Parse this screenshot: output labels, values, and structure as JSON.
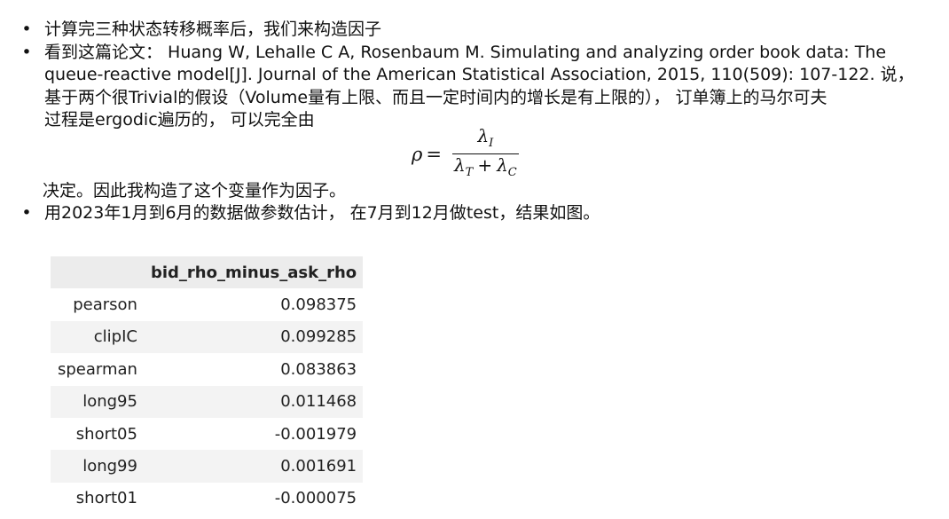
{
  "bullets": {
    "b1": "计算完三种状态转移概率后，我们来构造因子",
    "b2_line1": "看到这篇论文：  Huang W, Lehalle C A, Rosenbaum M. Simulating and analyzing order book data: The",
    "b2_line2": "queue-reactive model[J]. Journal of the American Statistical Association, 2015, 110(509): 107-122. 说，",
    "b2_line3": "基于两个很Trivial的假设（Volume量有上限、而且一定时间内的增长是有上限的），  订单簿上的马尔可夫",
    "b2_line4": "过程是ergodic遍历的，  可以完全由",
    "b2_after": "决定。因此我构造了这个变量作为因子。",
    "b3": "用2023年1月到6月的数据做参数估计，  在7月到12月做test，结果如图。",
    "dot": "•"
  },
  "formula": {
    "lhs": "ρ",
    "equals": "=",
    "num_symbol": "λ",
    "num_sub": "I",
    "den_symbol1": "λ",
    "den_sub1": "T",
    "plus": "+",
    "den_symbol2": "λ",
    "den_sub2": "C"
  },
  "table": {
    "column_header": "bid_rho_minus_ask_rho",
    "rows": [
      {
        "label": "pearson",
        "value": "0.098375"
      },
      {
        "label": "clipIC",
        "value": "0.099285"
      },
      {
        "label": "spearman",
        "value": "0.083863"
      },
      {
        "label": "long95",
        "value": "0.011468"
      },
      {
        "label": "short05",
        "value": "-0.001979"
      },
      {
        "label": "long99",
        "value": "0.001691"
      },
      {
        "label": "short01",
        "value": "-0.000075"
      }
    ]
  }
}
